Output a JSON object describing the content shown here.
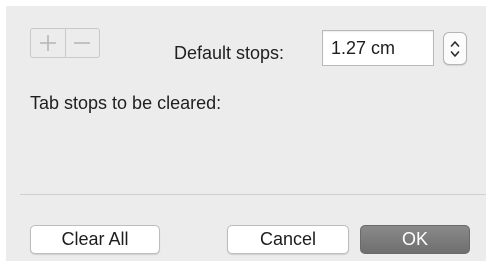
{
  "toolbar": {
    "add_icon": "plus-icon",
    "remove_icon": "minus-icon"
  },
  "default_stops": {
    "label": "Default stops:",
    "value": "1.27 cm",
    "stepper_icon": "up-down-chevron-icon"
  },
  "clear_section": {
    "label": "Tab stops to be cleared:"
  },
  "buttons": {
    "clear_all": "Clear All",
    "cancel": "Cancel",
    "ok": "OK"
  },
  "colors": {
    "dialog_background": "#ececec",
    "primary_button": "#7c7c7c",
    "icon_disabled": "#b8b8b8"
  }
}
